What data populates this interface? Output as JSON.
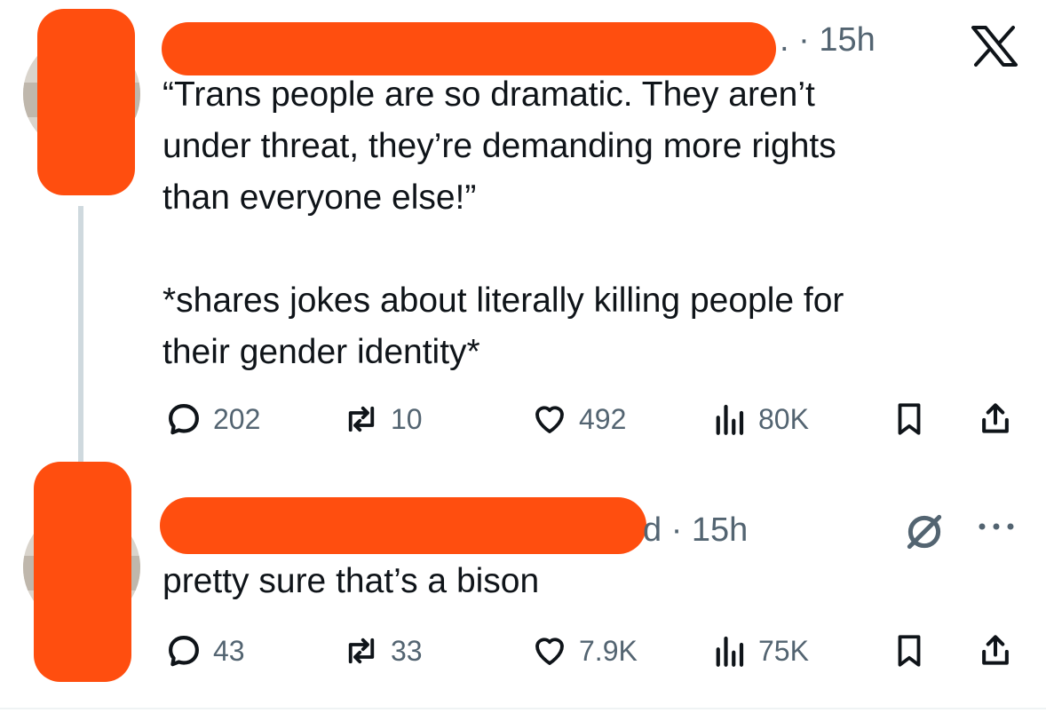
{
  "tweet1": {
    "time": ". · 15h",
    "text": "“Trans people are so dramatic. They aren’t\nunder threat, they’re demanding more rights\nthan everyone else!”\n\n*shares jokes about literally killing people for\ntheir gender identity*",
    "stats": {
      "replies": "202",
      "retweets": "10",
      "likes": "492",
      "views": "80K"
    },
    "close_icon": "x-logo-icon"
  },
  "tweet2": {
    "time": "d · 15h",
    "text": "pretty sure that’s a bison",
    "stats": {
      "replies": "43",
      "retweets": "33",
      "likes": "7.9K",
      "views": "75K"
    }
  },
  "colors": {
    "redaction": "#ff4e0f",
    "muted": "#536471",
    "text": "#0f1419",
    "line": "#cfd9de"
  }
}
